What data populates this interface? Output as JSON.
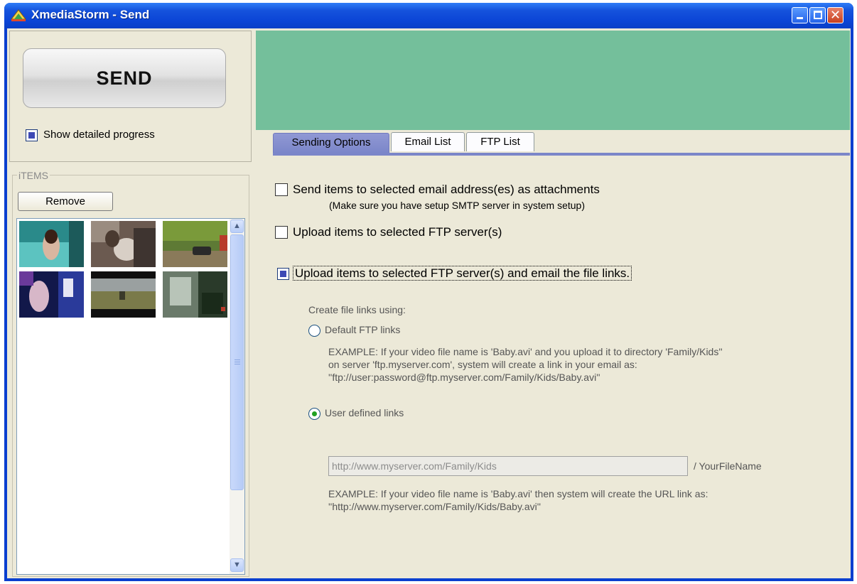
{
  "window": {
    "title": "XmediaStorm - Send"
  },
  "left": {
    "send_label": "SEND",
    "show_progress": {
      "label": "Show detailed progress",
      "checked": true
    },
    "items_group": {
      "legend": "iTEMS",
      "remove_label": "Remove"
    },
    "thumbnails": [
      {
        "icon": "video-thumbnail-1"
      },
      {
        "icon": "video-thumbnail-2"
      },
      {
        "icon": "video-thumbnail-3"
      },
      {
        "icon": "video-thumbnail-4"
      },
      {
        "icon": "video-thumbnail-5"
      },
      {
        "icon": "video-thumbnail-6"
      }
    ]
  },
  "colors": {
    "banner": "#74bf9b",
    "tab_active": "#7b86c9",
    "titlebar": "#0b45d6"
  },
  "tabs": [
    {
      "label": "Sending Options",
      "active": true
    },
    {
      "label": "Email List",
      "active": false
    },
    {
      "label": "FTP List",
      "active": false
    }
  ],
  "options": {
    "attach": {
      "label": "Send items to selected email address(es) as attachments",
      "checked": false,
      "note": "(Make sure you have setup SMTP server in system setup)"
    },
    "upload": {
      "label": "Upload items to selected FTP server(s)",
      "checked": false
    },
    "upload_email": {
      "label": "Upload items to selected FTP server(s) and email the file links.",
      "checked": true
    }
  },
  "links": {
    "heading": "Create file links using:",
    "default_ftp": {
      "label": "Default FTP links",
      "selected": false,
      "example": "EXAMPLE: If your video file name is 'Baby.avi' and you upload it to directory 'Family/Kids''\non server 'ftp.myserver.com', system will create a link in your email as:\n''ftp://user:password@ftp.myserver.com/Family/Kids/Baby.avi''"
    },
    "user_defined": {
      "label": "User defined links",
      "selected": true,
      "url_value": "http://www.myserver.com/Family/Kids",
      "suffix": "/ YourFileName",
      "example": "EXAMPLE: If your video file name is 'Baby.avi' then system will create the URL link as:\n''http://www.myserver.com/Family/Kids/Baby.avi''"
    }
  }
}
